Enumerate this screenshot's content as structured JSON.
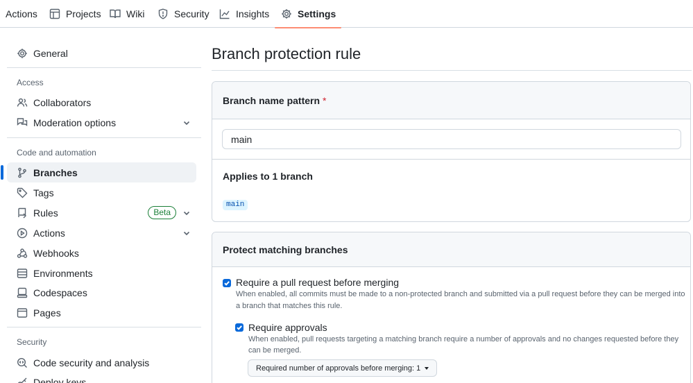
{
  "topnav": {
    "tabs": [
      {
        "label": "Actions",
        "icon": "play-icon"
      },
      {
        "label": "Projects",
        "icon": "table-icon"
      },
      {
        "label": "Wiki",
        "icon": "book-icon"
      },
      {
        "label": "Security",
        "icon": "shield-icon"
      },
      {
        "label": "Insights",
        "icon": "graph-icon"
      },
      {
        "label": "Settings",
        "icon": "gear-icon",
        "selected": true
      }
    ]
  },
  "sidebar": {
    "general": "General",
    "sections": [
      {
        "heading": "Access",
        "items": [
          "Collaborators",
          "Moderation options"
        ]
      },
      {
        "heading": "Code and automation",
        "items": [
          "Branches",
          "Tags",
          "Rules",
          "Actions",
          "Webhooks",
          "Environments",
          "Codespaces",
          "Pages"
        ]
      },
      {
        "heading": "Security",
        "items": [
          "Code security and analysis",
          "Deploy keys"
        ]
      }
    ],
    "active_item": "Branches",
    "rules_badge": "Beta"
  },
  "main": {
    "title": "Branch protection rule",
    "name_pattern": {
      "header": "Branch name pattern",
      "required_marker": "*",
      "value": "main"
    },
    "applies": {
      "title": "Applies to 1 branch",
      "branches": [
        "main"
      ]
    },
    "protect": {
      "header": "Protect matching branches",
      "require_pr": {
        "checked": true,
        "label": "Require a pull request before merging",
        "desc_line1": "When enabled, all commits must be made to a non-protected branch and submitted via a pull request before they can be merged into",
        "desc_line2": "a branch that matches this rule."
      },
      "require_approvals": {
        "checked": true,
        "label": "Require approvals",
        "desc_line1": "When enabled, pull requests targeting a matching branch require a number of approvals and no changes requested before they",
        "desc_line2": "can be merged.",
        "select_label": "Required number of approvals before merging: 1"
      }
    }
  },
  "colors": {
    "accent": "#0969da",
    "tab_underline": "#fd8c73",
    "beta_green": "#1a7f37",
    "required_red": "#cf222e"
  }
}
